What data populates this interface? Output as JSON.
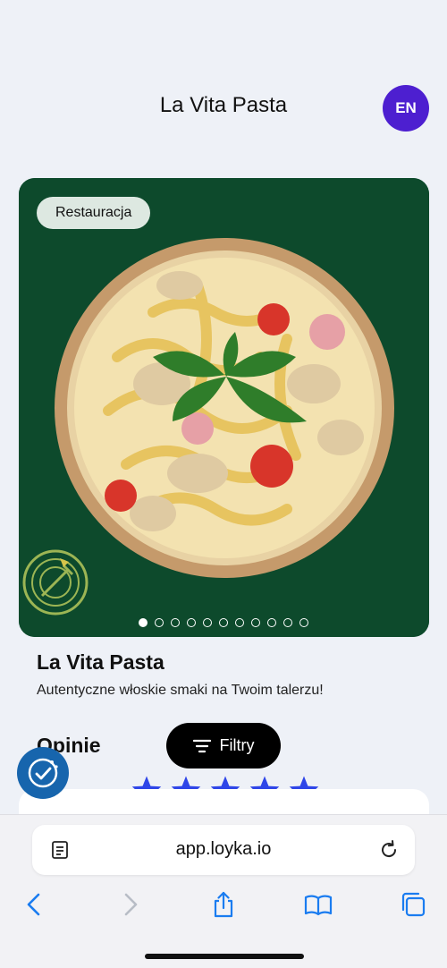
{
  "header": {
    "title": "La Vita Pasta",
    "language_button": "EN"
  },
  "hero": {
    "badge": "Restauracja",
    "image_count": 11,
    "active_image": 1
  },
  "restaurant": {
    "name": "La Vita Pasta",
    "tagline": "Autentyczne włoskie smaki na Twoim talerzu!"
  },
  "reviews": {
    "title": "Opinie",
    "rating": 5,
    "max_rating": 5
  },
  "filter_button": {
    "label": "Filtry"
  },
  "browser": {
    "url": "app.loyka.io"
  },
  "colors": {
    "accent": "#4d1fd0",
    "hero_bg": "#0d4a2c",
    "star": "#2f46e8",
    "help_button": "#1765ad",
    "ios_blue": "#1a7cf0"
  },
  "icons": {
    "help": "food-check-icon",
    "filter": "filter-lines-icon",
    "reader": "reader-mode-icon",
    "reload": "reload-icon",
    "toolbar": [
      "back-icon",
      "forward-icon",
      "share-icon",
      "bookmarks-icon",
      "tabs-icon"
    ]
  }
}
